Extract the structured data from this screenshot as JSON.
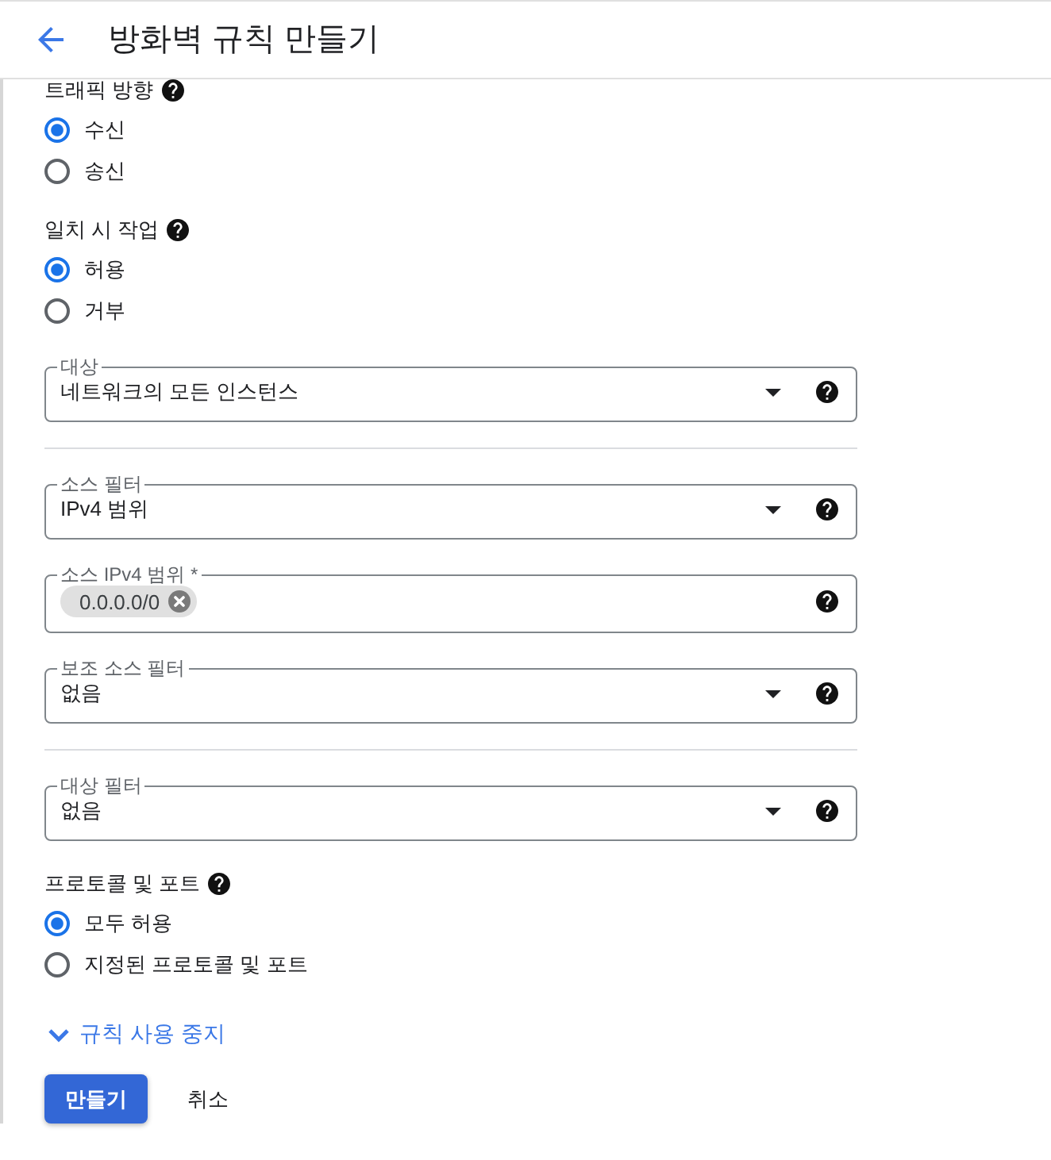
{
  "header": {
    "title": "방화벽 규칙 만들기"
  },
  "sections": [
    {
      "items": [
        {
          "kind": "radio_group",
          "label": "트래픽 방향",
          "options": [
            {
              "label": "수신",
              "selected": true
            },
            {
              "label": "송신",
              "selected": false
            }
          ]
        },
        {
          "kind": "radio_group",
          "label": "일치 시 작업",
          "options": [
            {
              "label": "허용",
              "selected": true
            },
            {
              "label": "거부",
              "selected": false
            }
          ]
        },
        {
          "kind": "select",
          "label": "대상",
          "value": "네트워크의 모든 인스턴스"
        }
      ]
    },
    {
      "items": [
        {
          "kind": "select",
          "label": "소스 필터",
          "value": "IPv4 범위"
        },
        {
          "kind": "chips",
          "label": "소스 IPv4 범위 *",
          "chips": [
            "0.0.0.0/0"
          ]
        },
        {
          "kind": "select",
          "label": "보조 소스 필터",
          "value": "없음"
        }
      ]
    },
    {
      "items": [
        {
          "kind": "select",
          "label": "대상 필터",
          "value": "없음"
        },
        {
          "kind": "radio_group",
          "label": "프로토콜 및 포트",
          "options": [
            {
              "label": "모두 허용",
              "selected": true
            },
            {
              "label": "지정된 프로토콜 및 포트",
              "selected": false
            }
          ]
        }
      ]
    }
  ],
  "expander": {
    "label": "규칙 사용 중지",
    "expanded": false
  },
  "buttons": [
    {
      "kind": "primary",
      "label": "만들기"
    },
    {
      "kind": "flat",
      "label": "취소"
    }
  ]
}
